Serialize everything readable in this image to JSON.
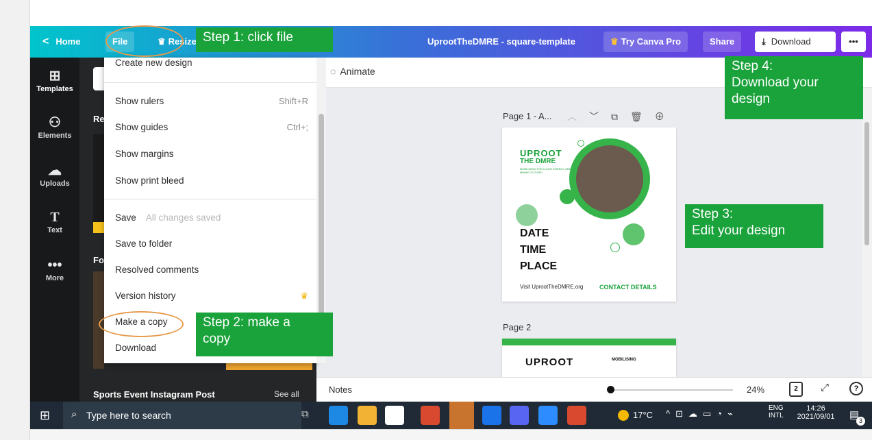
{
  "topbar": {
    "home_label": "Home",
    "file_label": "File",
    "resize_label": "Resize",
    "doc_title": "UprootTheDMRE - square-template",
    "try_pro_label": "Try Canva Pro",
    "share_label": "Share",
    "download_label": "Download",
    "more_label": "•••"
  },
  "rail": {
    "items": [
      {
        "label": "Templates"
      },
      {
        "label": "Elements"
      },
      {
        "label": "Uploads"
      },
      {
        "label": "Text"
      },
      {
        "label": "More"
      }
    ]
  },
  "panel": {
    "section_partial_1": "Re",
    "section_partial_2": "Fo",
    "bottom_title": "Sports Event Instagram Post",
    "see_all": "See all"
  },
  "file_menu": {
    "items": [
      {
        "label": "Create new design",
        "shortcut": ""
      },
      {
        "label": "Show rulers",
        "shortcut": "Shift+R"
      },
      {
        "label": "Show guides",
        "shortcut": "Ctrl+;"
      },
      {
        "label": "Show margins",
        "shortcut": ""
      },
      {
        "label": "Show print bleed",
        "shortcut": ""
      },
      {
        "label": "Save",
        "note": "All changes saved"
      },
      {
        "label": "Save to folder",
        "shortcut": ""
      },
      {
        "label": "Resolved comments",
        "shortcut": ""
      },
      {
        "label": "Version history",
        "shortcut": ""
      },
      {
        "label": "Make a copy",
        "shortcut": ""
      },
      {
        "label": "Download",
        "shortcut": ""
      }
    ]
  },
  "canvas": {
    "animate_label": "Animate",
    "page1_label": "Page 1 - A...",
    "page2_label": "Page 2",
    "design": {
      "logo_line1": "UPROOT",
      "logo_line2": "THE DMRE",
      "tagline": "MOBILISING FOR A JUST ENERGY AND MINING FUTURE!",
      "date": "DATE",
      "time": "TIME",
      "place": "PLACE",
      "website": "Visit UprootTheDMRE.org",
      "contact": "CONTACT DETAILS"
    },
    "page2_logo": "UPROOT",
    "page2_tagline": "MOBILISING"
  },
  "notes_bar": {
    "notes_label": "Notes",
    "zoom": "24%",
    "page_count": "2",
    "help": "?"
  },
  "steps": {
    "step1": "Step 1: click file",
    "step2_line1": "Step 2: make a",
    "step2_line2": "copy",
    "step3_line1": "Step 3:",
    "step3_line2": "Edit your design",
    "step4_line1": "Step 4:",
    "step4_line2": "Download your",
    "step4_line3": "design"
  },
  "taskbar": {
    "search_placeholder": "Type here to search",
    "weather": "17°C",
    "lang_line1": "ENG",
    "lang_line2": "INTL",
    "time": "14:26",
    "date": "2021/09/01",
    "notif_count": "3"
  },
  "colors": {
    "step_green": "#1aa23b",
    "brand_purple": "#7d2ae8",
    "brand_teal": "#00c4cc",
    "design_green": "#36b44a"
  }
}
